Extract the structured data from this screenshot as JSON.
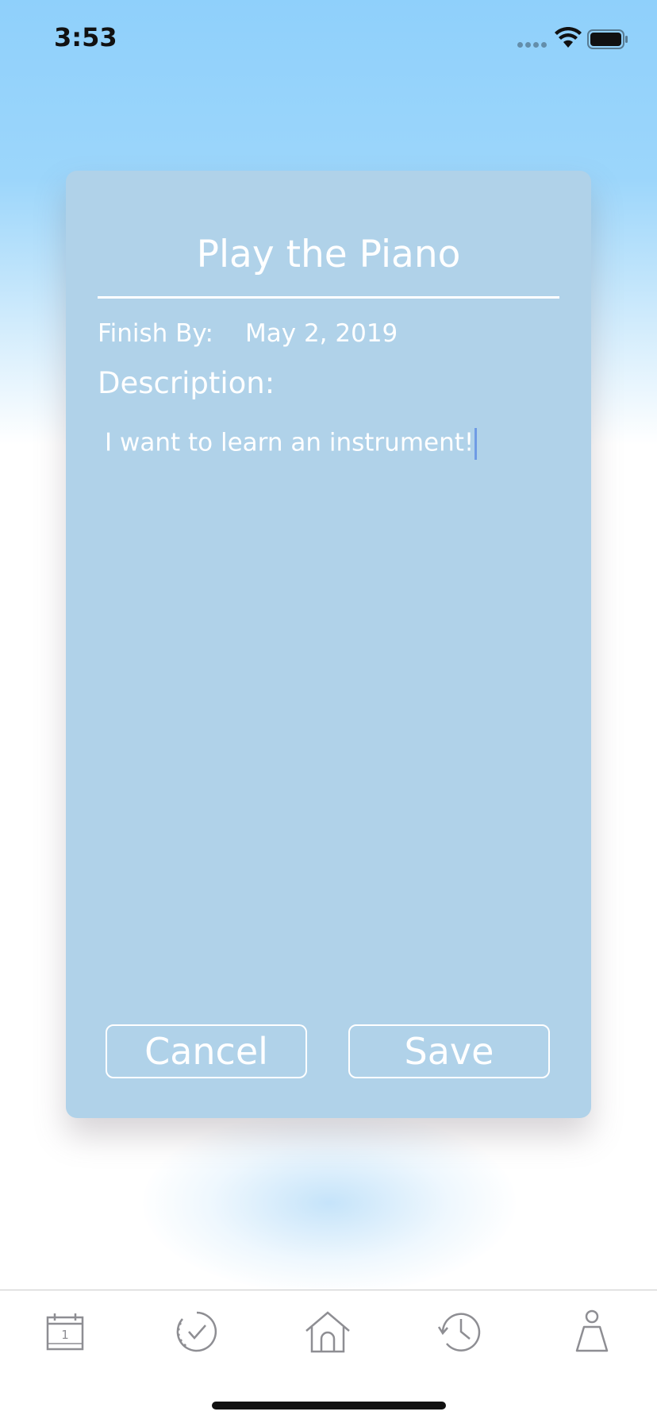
{
  "status_bar": {
    "time": "3:53"
  },
  "card": {
    "title": "Play the Piano",
    "finish_by_label": "Finish By:",
    "finish_by_value": "May 2, 2019",
    "description_label": "Description:",
    "description_text": "I want to learn an instrument!",
    "cancel_label": "Cancel",
    "save_label": "Save",
    "background_color": "#b0d2e9"
  },
  "tab_bar": {
    "items": [
      {
        "icon": "calendar-icon",
        "badge_text": "1"
      },
      {
        "icon": "check-circle-icon"
      },
      {
        "icon": "home-icon"
      },
      {
        "icon": "history-icon"
      },
      {
        "icon": "profile-icon"
      }
    ],
    "icon_color": "#8e8e93"
  }
}
